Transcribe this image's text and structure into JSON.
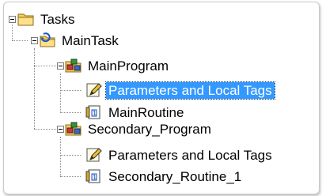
{
  "tree": {
    "tasks": {
      "label": "Tasks",
      "icon": "folder-icon",
      "expanded": true,
      "children": {
        "main_task": {
          "label": "MainTask",
          "icon": "task-icon",
          "expanded": true
        }
      }
    },
    "programs": [
      {
        "label": "MainProgram",
        "icon": "program-icon",
        "expanded": true,
        "children": [
          {
            "label": "Parameters and Local Tags",
            "icon": "tag-icon",
            "selected": true
          },
          {
            "label": "MainRoutine",
            "icon": "routine-icon",
            "selected": false
          }
        ]
      },
      {
        "label": "Secondary_Program",
        "icon": "program-icon",
        "expanded": true,
        "children": [
          {
            "label": "Parameters and Local Tags",
            "icon": "tag-icon",
            "selected": false
          },
          {
            "label": "Secondary_Routine_1",
            "icon": "routine-icon",
            "selected": false
          }
        ]
      }
    ]
  },
  "colors": {
    "selection": "#3399ff",
    "folder": "#f5cf5a",
    "lines": "#8a8a8a"
  }
}
